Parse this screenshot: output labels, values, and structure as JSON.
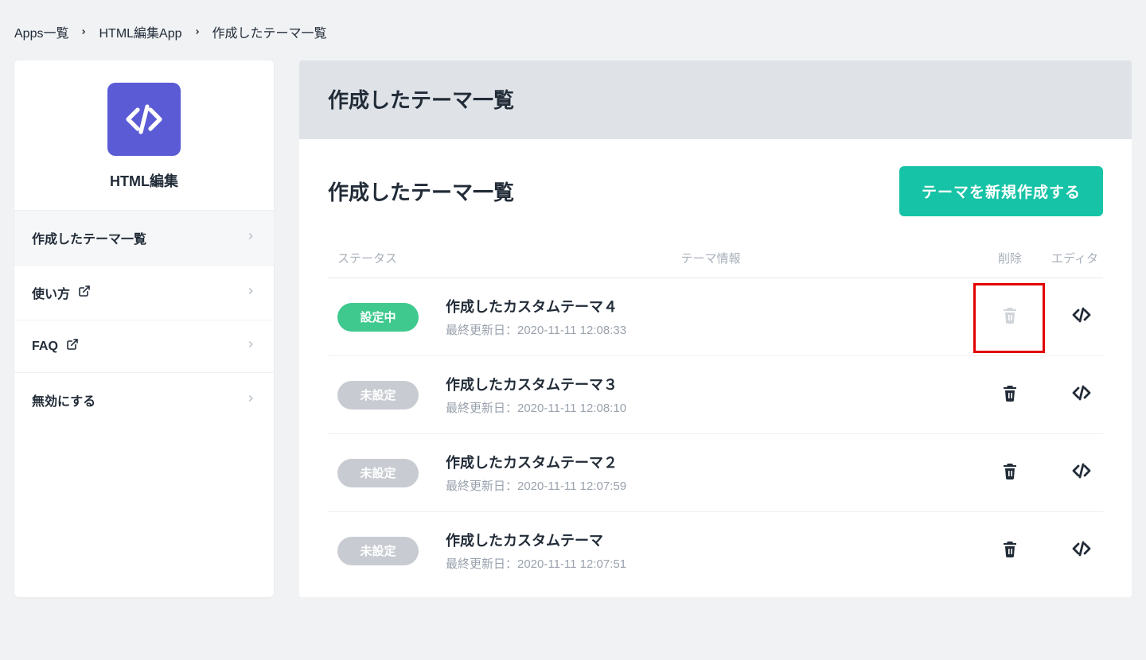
{
  "breadcrumb": {
    "items": [
      "Apps一覧",
      "HTML編集App",
      "作成したテーマ一覧"
    ]
  },
  "sidebar": {
    "app_title": "HTML編集",
    "items": [
      {
        "label": "作成したテーマ一覧",
        "external": false,
        "active": true
      },
      {
        "label": "使い方",
        "external": true,
        "active": false
      },
      {
        "label": "FAQ",
        "external": true,
        "active": false
      },
      {
        "label": "無効にする",
        "external": false,
        "active": false
      }
    ]
  },
  "main": {
    "header_title": "作成したテーマ一覧",
    "panel_title": "作成したテーマ一覧",
    "new_button": "テーマを新規作成する",
    "columns": {
      "status": "ステータス",
      "info": "テーマ情報",
      "delete": "削除",
      "editor": "エディタ"
    },
    "meta_prefix": "最終更新日：",
    "status_labels": {
      "active": "設定中",
      "inactive": "未設定"
    },
    "rows": [
      {
        "name": "作成したカスタムテーマ４",
        "updated": "2020-11-11 12:08:33",
        "status": "active",
        "delete_enabled": false,
        "highlight_delete": true
      },
      {
        "name": "作成したカスタムテーマ３",
        "updated": "2020-11-11 12:08:10",
        "status": "inactive",
        "delete_enabled": true,
        "highlight_delete": false
      },
      {
        "name": "作成したカスタムテーマ２",
        "updated": "2020-11-11 12:07:59",
        "status": "inactive",
        "delete_enabled": true,
        "highlight_delete": false
      },
      {
        "name": "作成したカスタムテーマ",
        "updated": "2020-11-11 12:07:51",
        "status": "inactive",
        "delete_enabled": true,
        "highlight_delete": false
      }
    ]
  }
}
